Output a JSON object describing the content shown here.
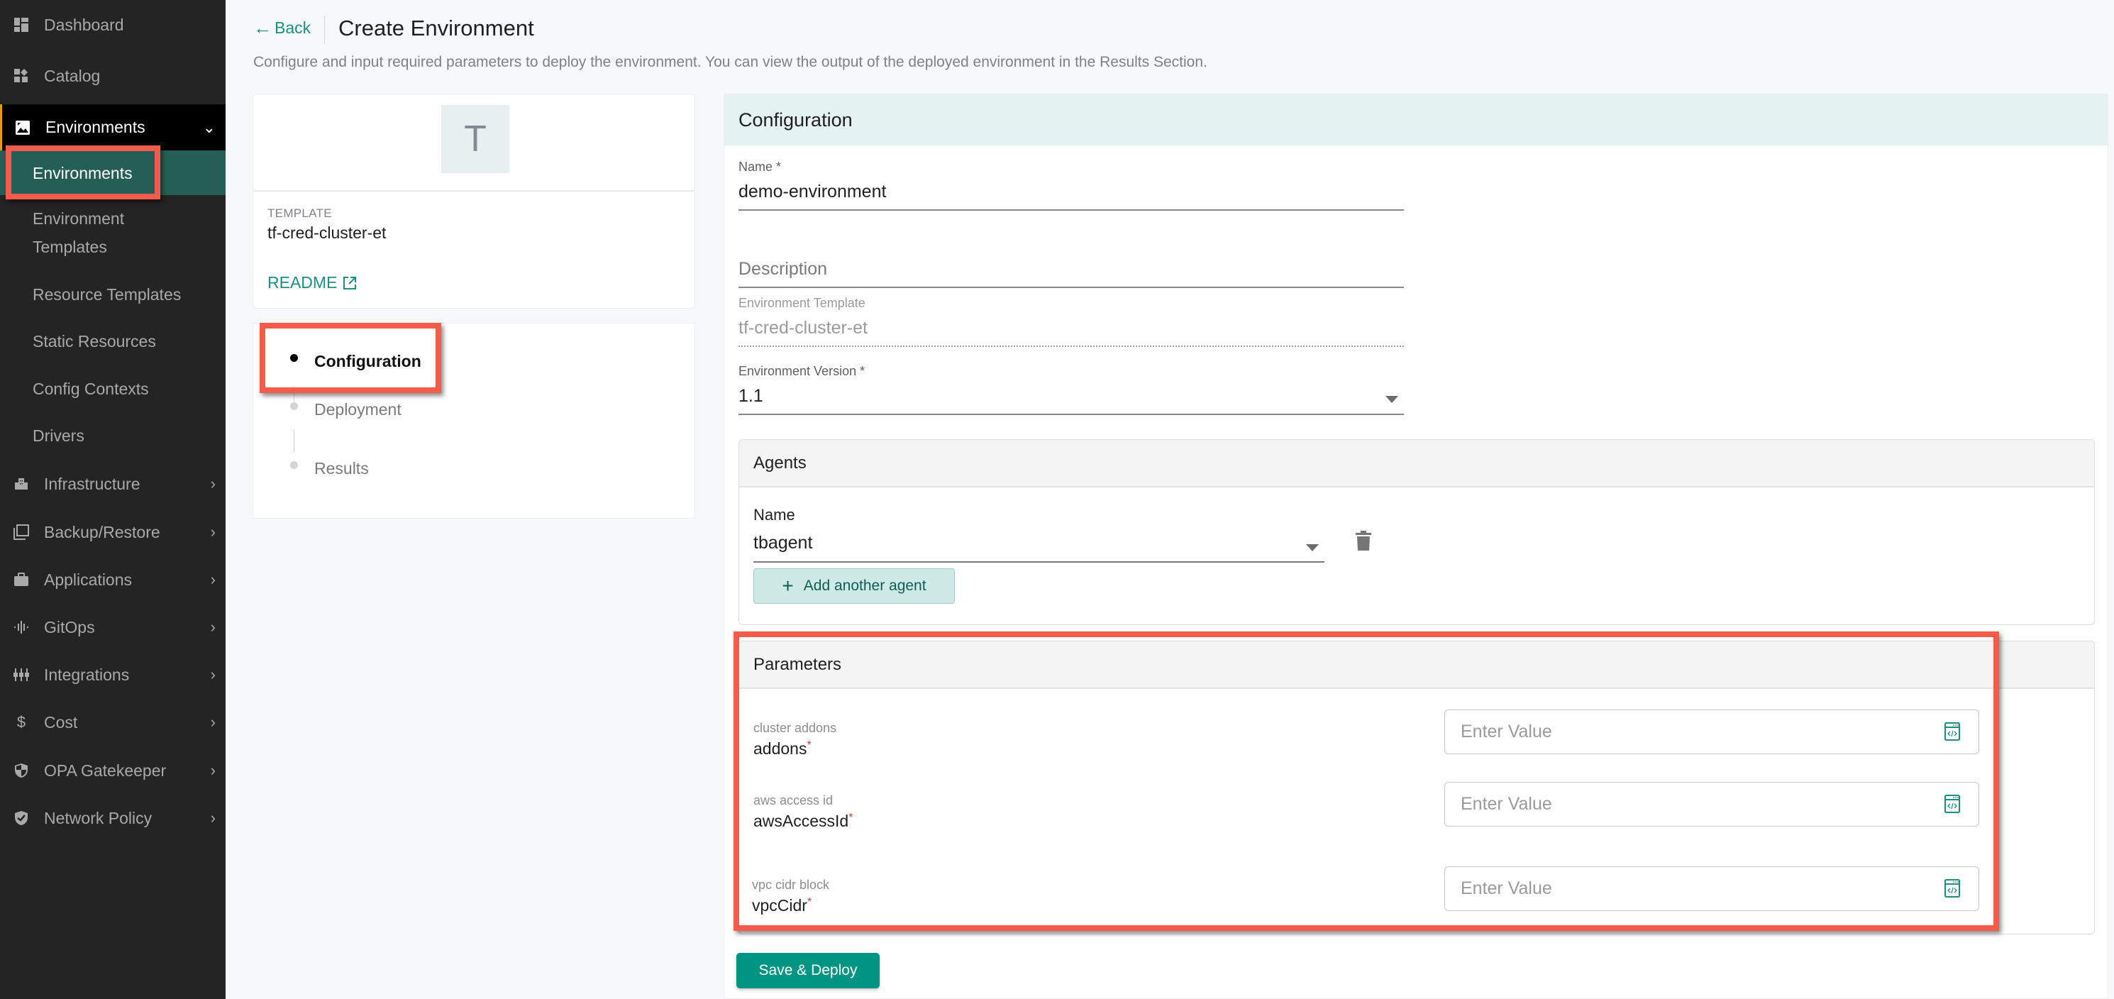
{
  "sidebar": {
    "items": [
      {
        "label": "Dashboard",
        "icon": "dashboard-icon"
      },
      {
        "label": "Catalog",
        "icon": "catalog-icon"
      },
      {
        "label": "Environments",
        "icon": "environments-icon",
        "expanded": true
      },
      {
        "label": "Infrastructure",
        "icon": "infrastructure-icon"
      },
      {
        "label": "Backup/Restore",
        "icon": "backup-icon"
      },
      {
        "label": "Applications",
        "icon": "briefcase-icon"
      },
      {
        "label": "GitOps",
        "icon": "gitops-icon"
      },
      {
        "label": "Integrations",
        "icon": "integrations-icon"
      },
      {
        "label": "Cost",
        "icon": "dollar-icon"
      },
      {
        "label": "OPA Gatekeeper",
        "icon": "shield-icon"
      },
      {
        "label": "Network Policy",
        "icon": "shield-check-icon"
      }
    ],
    "env_sub_items": [
      {
        "label": "Environments",
        "active": true
      },
      {
        "label": "Environment Templates"
      },
      {
        "label": "Resource Templates"
      },
      {
        "label": "Static Resources"
      },
      {
        "label": "Config Contexts"
      },
      {
        "label": "Drivers"
      }
    ],
    "env_templates_line1": "Environment",
    "env_templates_line2": "Templates"
  },
  "header": {
    "back_label": "Back",
    "title": "Create Environment",
    "subtitle": "Configure and input required parameters to deploy the environment. You can view the output of the deployed environment in the Results Section."
  },
  "template_card": {
    "avatar_letter": "T",
    "label": "TEMPLATE",
    "name": "tf-cred-cluster-et",
    "readme_label": "README"
  },
  "stepper": {
    "steps": [
      {
        "label": "Configuration",
        "active": true
      },
      {
        "label": "Deployment",
        "active": false
      },
      {
        "label": "Results",
        "active": false
      }
    ]
  },
  "configuration": {
    "title": "Configuration",
    "name_label": "Name *",
    "name_value": "demo-environment",
    "description_placeholder": "Description",
    "template_label": "Environment Template",
    "template_value": "tf-cred-cluster-et",
    "version_label": "Environment Version *",
    "version_value": "1.1"
  },
  "agents": {
    "title": "Agents",
    "name_label": "Name",
    "selected": "tbagent",
    "add_label": "Add another agent"
  },
  "parameters": {
    "title": "Parameters",
    "items": [
      {
        "description": "cluster addons",
        "name": "addons",
        "required": "*",
        "placeholder": "Enter Value"
      },
      {
        "description": "aws access id",
        "name": "awsAccessId",
        "required": "*",
        "placeholder": "Enter Value"
      },
      {
        "description": "vpc cidr block",
        "name": "vpcCidr",
        "required": "*",
        "placeholder": "Enter Value"
      }
    ]
  },
  "actions": {
    "save_deploy_label": "Save & Deploy"
  },
  "colors": {
    "accent": "#009483",
    "sidebar_bg": "#242424",
    "sidebar_active": "#245e57",
    "annotation": "#f45b4b"
  }
}
